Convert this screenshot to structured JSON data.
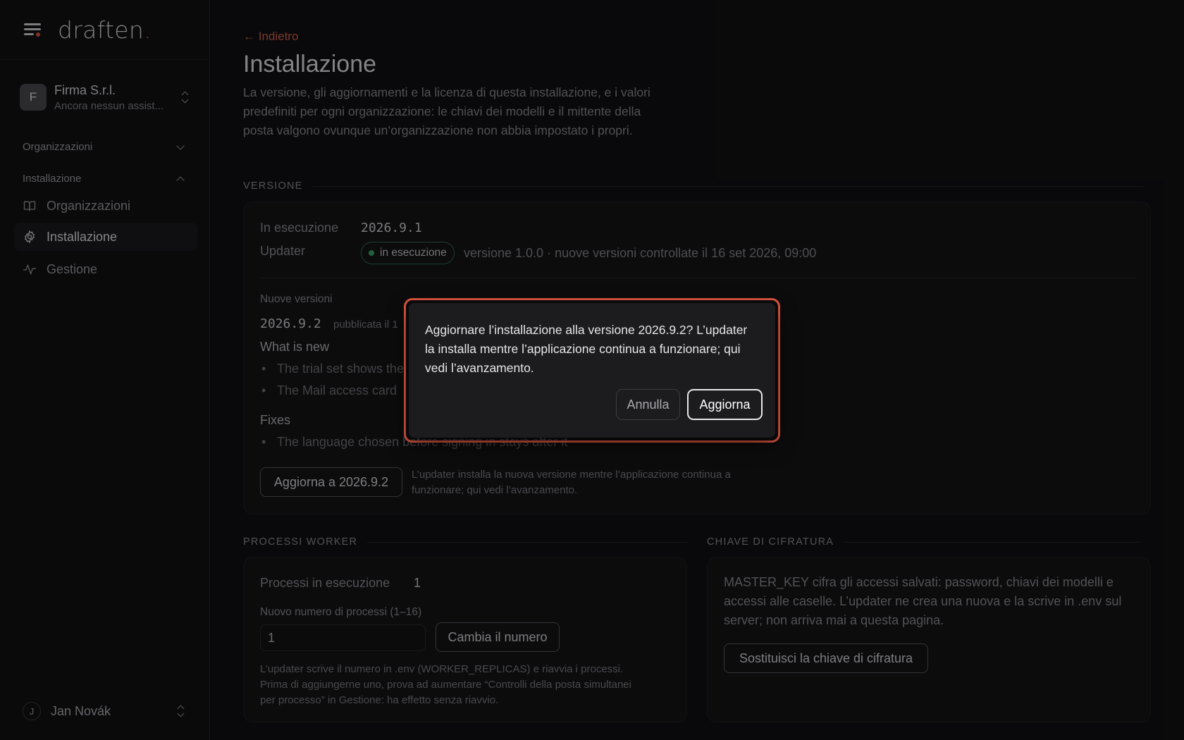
{
  "brand": {
    "name": "draften",
    "dot": "."
  },
  "org": {
    "initial": "F",
    "name": "Firma S.r.l.",
    "subtitle": "Ancora nessun assist..."
  },
  "sidebar": {
    "sections": [
      {
        "label": "Organizzazioni",
        "expanded": false
      },
      {
        "label": "Installazione",
        "expanded": true
      }
    ],
    "items": [
      {
        "label": "Organizzazioni",
        "icon": "book-icon",
        "active": false
      },
      {
        "label": "Installazione",
        "icon": "gear-icon",
        "active": true
      },
      {
        "label": "Gestione",
        "icon": "activity-icon",
        "active": false
      }
    ]
  },
  "user": {
    "initial": "J",
    "name": "Jan Novák"
  },
  "page": {
    "back": "← Indietro",
    "title": "Installazione",
    "description": "La versione, gli aggiornamenti e la licenza di questa installazione, e i valori predefiniti per ogni organizzazione: le chiavi dei modelli e il mittente della posta valgono ovunque un’organizzazione non abbia impostato i propri."
  },
  "version": {
    "section_label": "VERSIONE",
    "running_label": "In esecuzione",
    "running_value": "2026.9.1",
    "updater_label": "Updater",
    "updater_status": "in esecuzione",
    "updater_info": "versione 1.0.0 · nuove versioni controllate il 16 set 2026, 09:00",
    "new_versions_label": "Nuove versioni",
    "new_version": "2026.9.2",
    "published": "pubblicata il 1",
    "whats_new_title": "What is new",
    "whats_new": [
      "The trial set shows the",
      "The Mail access card"
    ],
    "fixes_title": "Fixes",
    "fixes": [
      "The language chosen before signing in stays after it"
    ],
    "update_button": "Aggiorna a 2026.9.2",
    "update_note": "L’updater installa la nuova versione mentre l’applicazione continua a funzionare; qui vedi l’avanzamento."
  },
  "workers": {
    "section_label": "PROCESSI WORKER",
    "running_label": "Processi in esecuzione",
    "running_value": "1",
    "new_label": "Nuovo numero di processi (1–16)",
    "input_value": "1",
    "change_button": "Cambia il numero",
    "note": "L’updater scrive il numero in .env (WORKER_REPLICAS) e riavvia i processi. Prima di aggiungerne uno, prova ad aumentare “Controlli della posta simultanei per processo” in Gestione: ha effetto senza riavvio."
  },
  "encryption": {
    "section_label": "CHIAVE DI CIFRATURA",
    "text": "MASTER_KEY cifra gli accessi salvati: password, chiavi dei modelli e accessi alle caselle. L’updater ne crea una nuova e la scrive in .env sul server; non arriva mai a questa pagina.",
    "button": "Sostituisci la chiave di cifratura"
  },
  "dialog": {
    "message": "Aggiornare l’installazione alla versione 2026.9.2? L’updater la installa mentre l’applicazione continua a funzionare; qui vedi l’avanzamento.",
    "cancel": "Annulla",
    "confirm": "Aggiorna"
  },
  "colors": {
    "accent": "#e0533e",
    "status_green": "#38a86a"
  }
}
